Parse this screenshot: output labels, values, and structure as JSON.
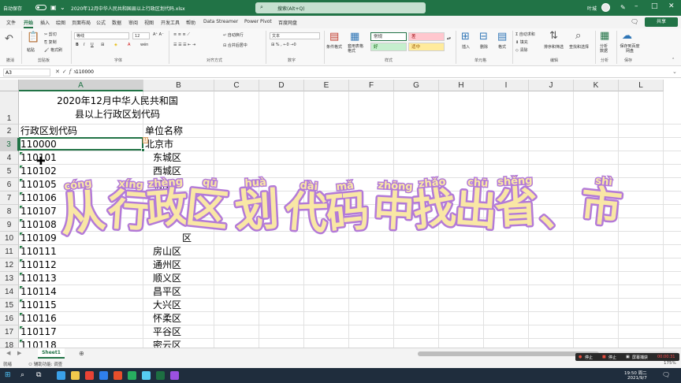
{
  "window": {
    "autosave_label": "自动保存",
    "title": "2020年12月中华人民共和国县以上行政区划代码.xlsx",
    "search_placeholder": "搜索(Alt+Q)",
    "user_name": "叶城",
    "share_label": "共享"
  },
  "menu": [
    "文件",
    "开始",
    "插入",
    "绘图",
    "页面布局",
    "公式",
    "数据",
    "审阅",
    "视图",
    "开发工具",
    "帮助",
    "Data Streamer",
    "Power Pivot",
    "百度网盘"
  ],
  "ribbon": {
    "clipboard": {
      "label": "剪贴板",
      "paste": "粘贴",
      "cut": "剪切",
      "copy": "复制",
      "format_painter": "格式刷"
    },
    "font": {
      "label": "字体",
      "name": "等线",
      "size": "12"
    },
    "alignment": {
      "label": "对齐方式",
      "wrap": "自动换行",
      "merge": "合并后居中"
    },
    "number": {
      "label": "数字",
      "format": "文本"
    },
    "styles": {
      "label": "样式",
      "conditional": "条件格式",
      "table": "套用表格格式",
      "normal": "常规",
      "bad": "差",
      "good": "好",
      "neutral": "适中"
    },
    "cells": {
      "label": "单元格",
      "insert": "插入",
      "delete": "删除",
      "format": "格式"
    },
    "editing": {
      "label": "编辑",
      "autosum": "自动求和",
      "fill": "填充",
      "clear": "清除",
      "sort": "排序和筛选",
      "find": "查找和选择"
    },
    "analysis": {
      "label": "分析",
      "analyze": "分析数据"
    },
    "save": {
      "label": "保存",
      "baidu": "保存到百度网盘"
    }
  },
  "formula_bar": {
    "name_box": "A3",
    "value": "110000"
  },
  "columns": [
    "A",
    "B",
    "C",
    "D",
    "E",
    "F",
    "G",
    "H",
    "I",
    "J",
    "K",
    "L"
  ],
  "rows": [
    "1",
    "2",
    "3",
    "4",
    "5",
    "6",
    "7",
    "8",
    "9",
    "10",
    "11",
    "12",
    "13",
    "14",
    "15",
    "16",
    "17",
    "18"
  ],
  "sheet": {
    "title_line1": "2020年12月中华人民共和国",
    "title_line2": "县以上行政区划代码",
    "header_code": "行政区划代码",
    "header_name": "单位名称",
    "codes": [
      "110000",
      "110101",
      "110102",
      "110105",
      "110106",
      "110107",
      "110108",
      "110109",
      "110111",
      "110112",
      "110113",
      "110114",
      "110115",
      "110116",
      "110117",
      "110118"
    ],
    "names": [
      "北京市",
      "东城区",
      "西城区",
      "朝阳区",
      "",
      "",
      "",
      "区",
      "房山区",
      "通州区",
      "顺义区",
      "昌平区",
      "大兴区",
      "怀柔区",
      "平谷区",
      "密云区"
    ]
  },
  "overlay": {
    "chars": [
      "从",
      "行",
      "政",
      "区",
      "划",
      "代",
      "码",
      "中",
      "找",
      "出",
      "省",
      "、",
      "市"
    ],
    "pinyin": [
      "cóng",
      "xíng",
      "zhèng",
      "qū",
      "huà",
      "dài",
      "mǎ",
      "zhōng",
      "zhǎo",
      "chū",
      "shěng",
      "",
      "shì"
    ]
  },
  "tabs": {
    "sheet1": "Sheet1"
  },
  "status": {
    "ready": "就绪",
    "accessibility": "辅助功能: 调查",
    "zoom": "175%"
  },
  "recorder": {
    "stop1": "停止",
    "stop2": "停止",
    "screen": "屏幕捕获",
    "time": "00:00:31"
  },
  "taskbar": {
    "time": "19:50 周二",
    "date": "2021/9/7"
  },
  "colors": {
    "excel_green": "#217346",
    "overlay_fill": "#f9e7a5",
    "overlay_stroke": "#b37ad8"
  }
}
